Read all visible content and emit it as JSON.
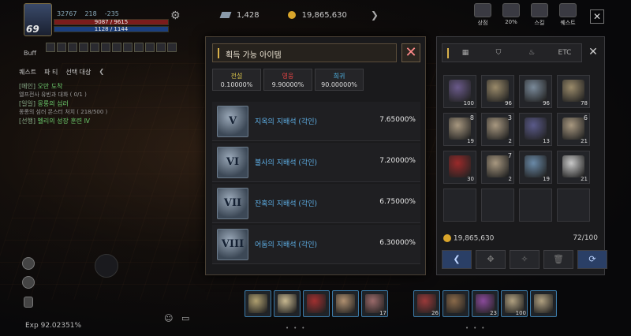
{
  "player": {
    "level": "69",
    "stat_a": "32767",
    "stat_b": "218",
    "stat_c": "-235",
    "hp": "9087 / 9615",
    "mp": "1128 / 1144",
    "buff_label": "Buff"
  },
  "currency": {
    "gems": "1,428",
    "gold": "19,865,630"
  },
  "right_menu": [
    {
      "label": "상점",
      "icon": "shop-icon"
    },
    {
      "label": "20%",
      "icon": "event-icon"
    },
    {
      "label": "스킬",
      "icon": "skill-icon"
    },
    {
      "label": "퀘스트",
      "icon": "quest-scroll-icon"
    }
  ],
  "quest_tabs": [
    "퀘스트",
    "파 티",
    "선택 대상"
  ],
  "quests": [
    {
      "label": "[메인]",
      "title": "오만 도착",
      "sub": "엘프전사 유빈과 대화 ( 0/1 )"
    },
    {
      "label": "[일일]",
      "title": "몽롱의 섬러",
      "sub": "몽롱의 섬러 몬스터 처치 ( 218/500 )"
    },
    {
      "label": "[선행]",
      "title": "벨리의 성장 훈련 Ⅳ",
      "sub": ""
    }
  ],
  "exp": "Exp  92.02351%",
  "modal": {
    "title": "획득 가능 아이템",
    "rarities": [
      {
        "name": "전설",
        "pct": "0.10000%",
        "color": "#d8c24a"
      },
      {
        "name": "영웅",
        "pct": "9.90000%",
        "color": "#e84444"
      },
      {
        "name": "희귀",
        "pct": "90.00000%",
        "color": "#4fb6e8"
      }
    ],
    "items": [
      {
        "numeral": "V",
        "name": "지옥의 지배석 (각인)",
        "pct": "7.65000%"
      },
      {
        "numeral": "VI",
        "name": "불사의 지배석 (각인)",
        "pct": "7.20000%"
      },
      {
        "numeral": "VII",
        "name": "잔혹의 지배석 (각인)",
        "pct": "6.75000%"
      },
      {
        "numeral": "VIII",
        "name": "어둠의 지배석 (각인)",
        "pct": "6.30000%"
      }
    ]
  },
  "inventory": {
    "tabs": [
      "",
      "",
      "",
      "",
      "ETC"
    ],
    "slots": [
      {
        "count": "100",
        "top": "",
        "color": "#6a5a8a"
      },
      {
        "count": "96",
        "top": "",
        "color": "#9a8a6a"
      },
      {
        "count": "96",
        "top": "",
        "color": "#7a8a9a"
      },
      {
        "count": "78",
        "top": "",
        "color": "#9a8a6a"
      },
      {
        "count": "19",
        "top": "8",
        "color": "#a89880"
      },
      {
        "count": "2",
        "top": "3",
        "color": "#a89880"
      },
      {
        "count": "13",
        "top": "",
        "color": "#5a5a8a"
      },
      {
        "count": "21",
        "top": "6",
        "color": "#a89880"
      },
      {
        "count": "30",
        "top": "",
        "color": "#9a2a2a"
      },
      {
        "count": "2",
        "top": "7",
        "color": "#a89880"
      },
      {
        "count": "19",
        "top": "",
        "color": "#6a8aa8"
      },
      {
        "count": "21",
        "top": "",
        "color": "#c8c8c8"
      },
      {
        "count": "",
        "top": "",
        "color": ""
      },
      {
        "count": "",
        "top": "",
        "color": ""
      },
      {
        "count": "",
        "top": "",
        "color": ""
      },
      {
        "count": "",
        "top": "",
        "color": ""
      }
    ],
    "gold": "19,865,630",
    "capacity": "72/100"
  },
  "hotbar_left": [
    {
      "count": "",
      "color": "#b0a070"
    },
    {
      "count": "",
      "color": "#c8b890"
    },
    {
      "count": "",
      "color": "#a03030"
    },
    {
      "count": "",
      "color": "#b09070"
    },
    {
      "count": "17",
      "color": "#9a6a6a"
    }
  ],
  "hotbar_right": [
    {
      "count": "26",
      "color": "#9a3a3a"
    },
    {
      "count": "",
      "color": "#8a6a4a"
    },
    {
      "count": "23",
      "color": "#8a4a9a"
    },
    {
      "count": "100",
      "color": "#b0a080"
    },
    {
      "count": "",
      "color": "#b0a080"
    }
  ]
}
